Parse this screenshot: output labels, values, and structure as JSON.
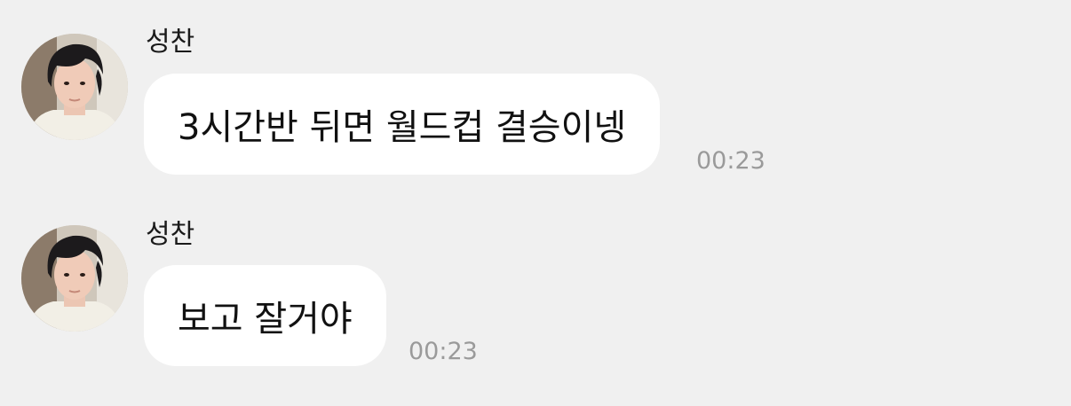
{
  "messages": [
    {
      "sender": "성찬",
      "text": "3시간반 뒤면 월드컵 결승이넹",
      "time": "00:23"
    },
    {
      "sender": "성찬",
      "text": "보고 잘거야",
      "time": "00:23"
    }
  ]
}
